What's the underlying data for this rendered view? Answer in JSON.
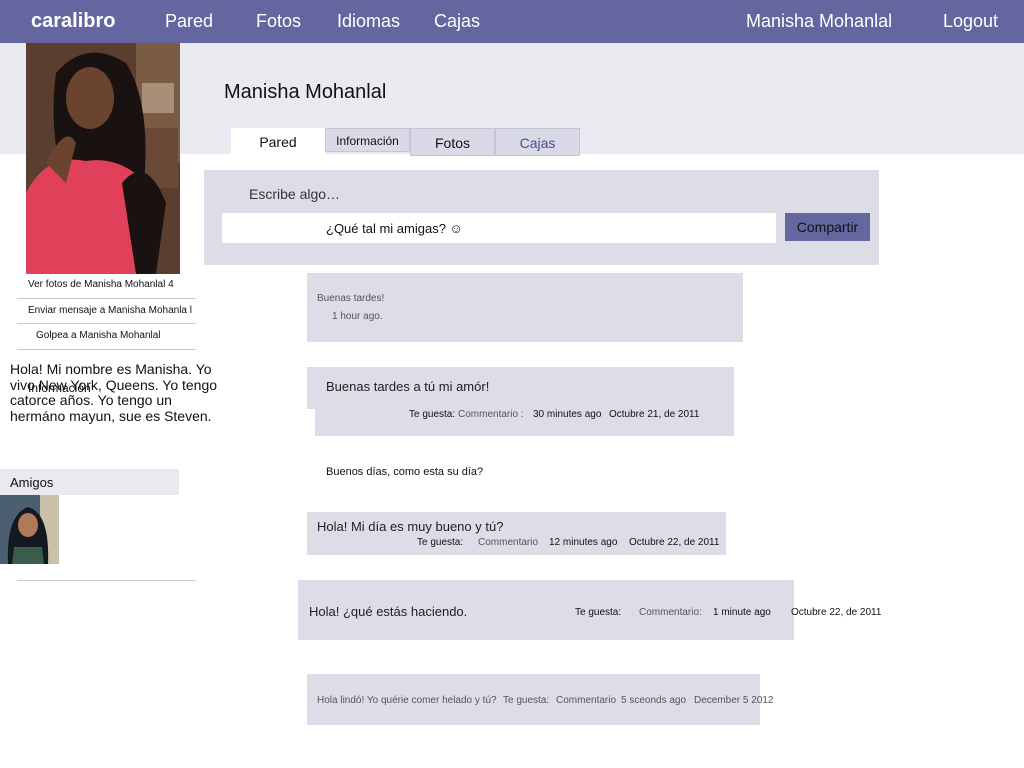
{
  "nav": {
    "brand": "caralibro",
    "items": [
      "Pared",
      "Fotos",
      "Idiomas",
      "Cajas"
    ],
    "user": "Manisha Mohanlal",
    "logout": "Logout"
  },
  "profile": {
    "name": "Manisha Mohanlal",
    "tabs": [
      "Pared",
      "Información",
      "Fotos",
      "Cajas"
    ]
  },
  "sidebar": {
    "links": [
      "Ver fotos de Manisha Mohanlal 4",
      "Enviar mensaje a Manisha Mohanla l",
      "Golpea a Manisha Mohanlal"
    ],
    "bio": "Hola! Mi nombre es Manisha. Yo vivo New York, Queens. Yo tengo catorce años. Yo  tengo un hermáno mayun, sue es Steven.",
    "info_label": "Información",
    "amigos_label": "Amigos"
  },
  "composer": {
    "prompt": "Escribe algo…",
    "input_value": "¿Qué tal mi amigas? ☺",
    "share_label": "Compartir"
  },
  "posts": [
    {
      "text": "Buenas tardes!",
      "time": "1 hour ago."
    },
    {
      "text": "Buenas tardes a tú mi amór!",
      "like": "Te guesta:",
      "comment": "Commentario :",
      "time": "30 minutes ago",
      "date": "Octubre 21, de 2011"
    },
    {
      "text": "Buenos días, como esta su día?"
    },
    {
      "text": "Hola! Mi día es  muy bueno y tú?",
      "like": "Te guesta:",
      "comment": "Commentario",
      "time": "12  minutes ago",
      "date": "Octubre 22, de 2011"
    },
    {
      "text": "Hola! ¿qué estás haciendo.",
      "like": "Te guesta:",
      "comment": "Commentario:",
      "time": "1 minute ago",
      "date": "Octubre 22, de 2011"
    },
    {
      "text": "Hola lindó! Yo quérie comer helado y tú?",
      "like": "Te guesta:",
      "comment": "Commentario",
      "time": "5 sceonds ago",
      "date": "December 5 2012"
    }
  ],
  "colors": {
    "topbar": "#6466a0",
    "band": "#e9eaf0",
    "post_bg": "#dcdde7"
  }
}
